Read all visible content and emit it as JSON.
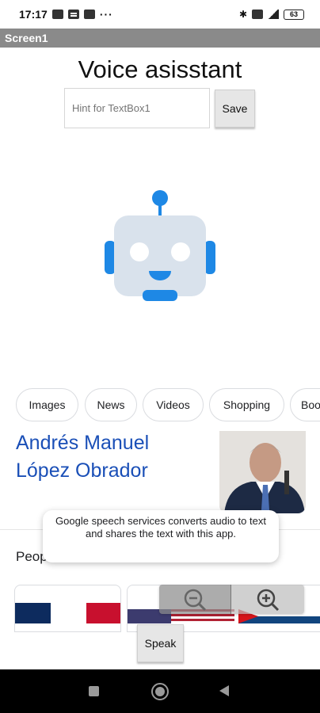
{
  "status_bar": {
    "time": "17:17",
    "battery": "63"
  },
  "app": {
    "screen_title": "Screen1",
    "heading": "Voice asisstant"
  },
  "form": {
    "textbox_placeholder": "Hint for TextBox1",
    "save_label": "Save"
  },
  "chips": [
    "Images",
    "News",
    "Videos",
    "Shopping",
    "Boo"
  ],
  "result": {
    "name_line1": "Andrés Manuel",
    "name_line2": "López Obrador"
  },
  "people_label": "Peop",
  "toast_text": "Google speech services converts audio to text and shares the text with this app.",
  "speak_label": "Speak",
  "colors": {
    "link_blue": "#1a4fb7",
    "robot_blue": "#1e88e5",
    "app_bar": "#8a8a8a"
  },
  "icons": [
    "message-icon",
    "chat-icon",
    "mail-icon",
    "bluetooth-icon",
    "signal-icon",
    "battery-icon",
    "robot-icon",
    "zoom-out-icon",
    "zoom-in-icon",
    "nav-recent-icon",
    "nav-home-icon",
    "nav-back-icon"
  ]
}
